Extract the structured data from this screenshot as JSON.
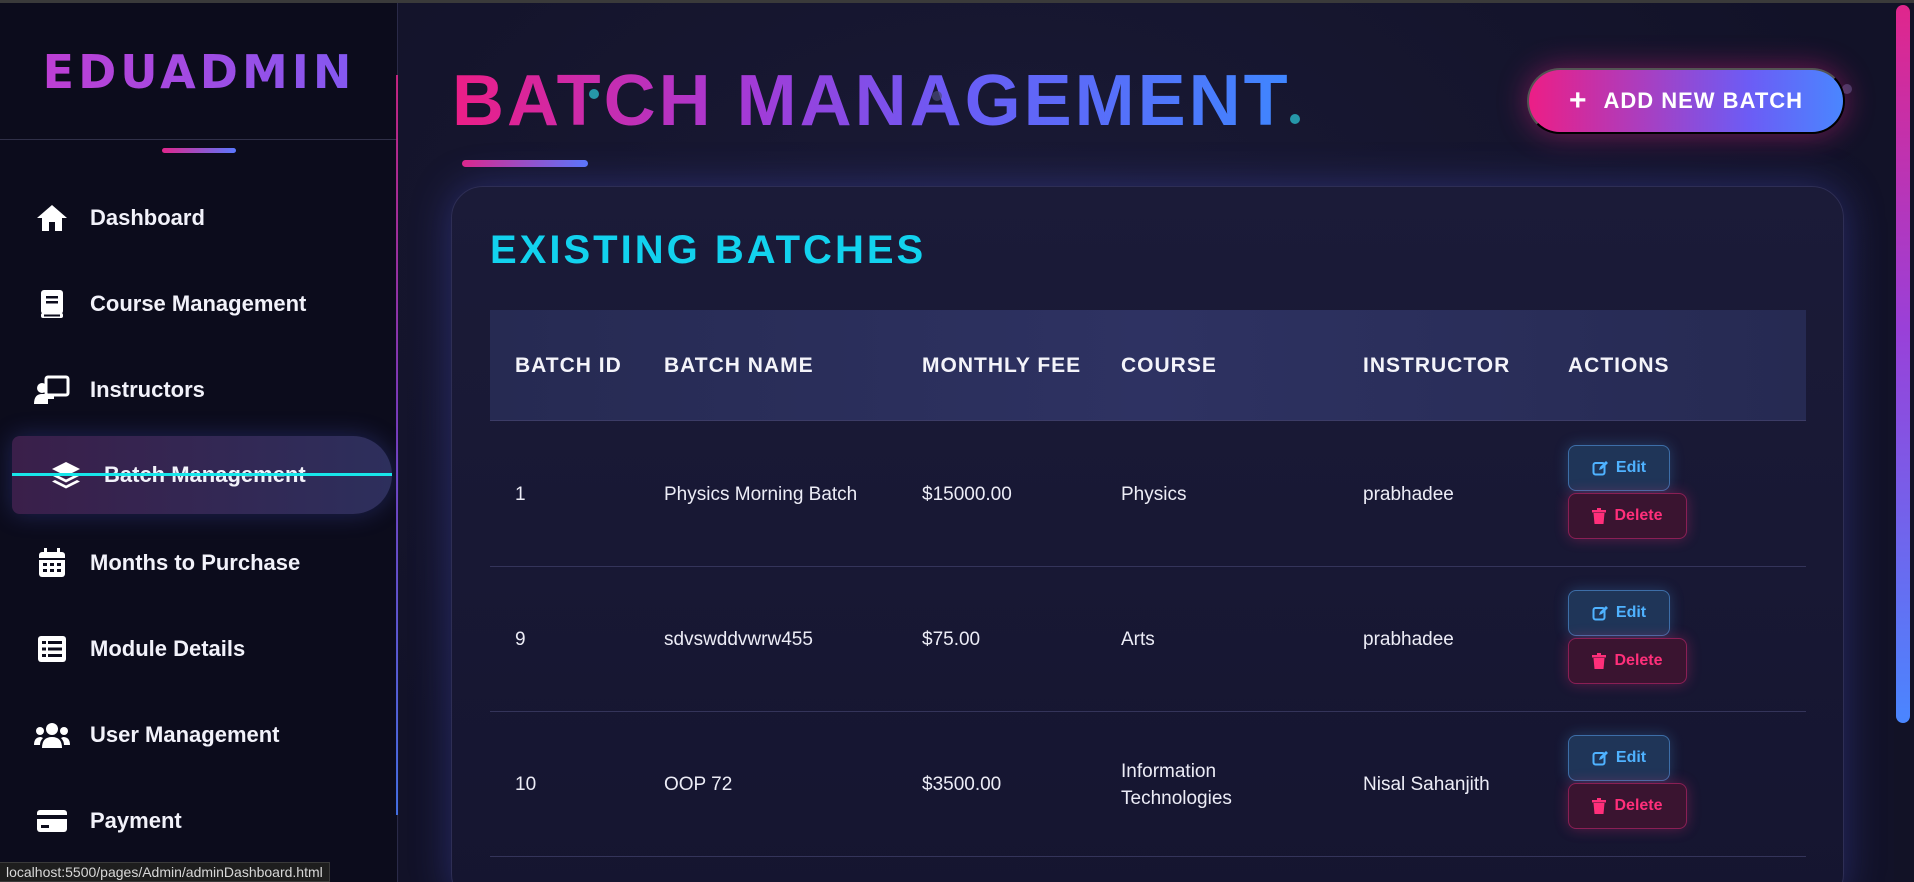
{
  "brand": {
    "name": "EDUADMIN"
  },
  "sidebar": {
    "items": [
      {
        "label": "Dashboard",
        "icon": "home-icon"
      },
      {
        "label": "Course Management",
        "icon": "book-icon"
      },
      {
        "label": "Instructors",
        "icon": "chalkboard-teacher-icon"
      },
      {
        "label": "Batch Management",
        "icon": "layers-icon",
        "active": true
      },
      {
        "label": "Months to Purchase",
        "icon": "calendar-icon"
      },
      {
        "label": "Module Details",
        "icon": "list-table-icon"
      },
      {
        "label": "User Management",
        "icon": "users-icon"
      },
      {
        "label": "Payment",
        "icon": "credit-card-icon"
      }
    ]
  },
  "header": {
    "title": "BATCH MANAGEMENT",
    "add_button_label": "ADD NEW BATCH"
  },
  "batches": {
    "title": "EXISTING BATCHES",
    "columns": [
      "BATCH ID",
      "BATCH NAME",
      "MONTHLY FEE",
      "COURSE",
      "INSTRUCTOR",
      "ACTIONS"
    ],
    "rows": [
      {
        "id": "1",
        "name": "Physics Morning Batch",
        "fee": "$15000.00",
        "course": "Physics",
        "instructor": "prabhadee"
      },
      {
        "id": "9",
        "name": "sdvswddvwrw455",
        "fee": "$75.00",
        "course": "Arts",
        "instructor": "prabhadee"
      },
      {
        "id": "10",
        "name": "OOP 72",
        "fee": "$3500.00",
        "course": "Information Technologies",
        "instructor": "Nisal Sahanjith"
      }
    ],
    "edit_label": "Edit",
    "delete_label": "Delete"
  },
  "status_bar": {
    "url": "localhost:5500/pages/Admin/adminDashboard.html"
  },
  "colors": {
    "accent_pink": "#ec1e86",
    "accent_blue": "#4a86ff",
    "section_title": "#12d2ee",
    "edit_text": "#4fb2ff",
    "delete_text": "#ff2f7a"
  }
}
